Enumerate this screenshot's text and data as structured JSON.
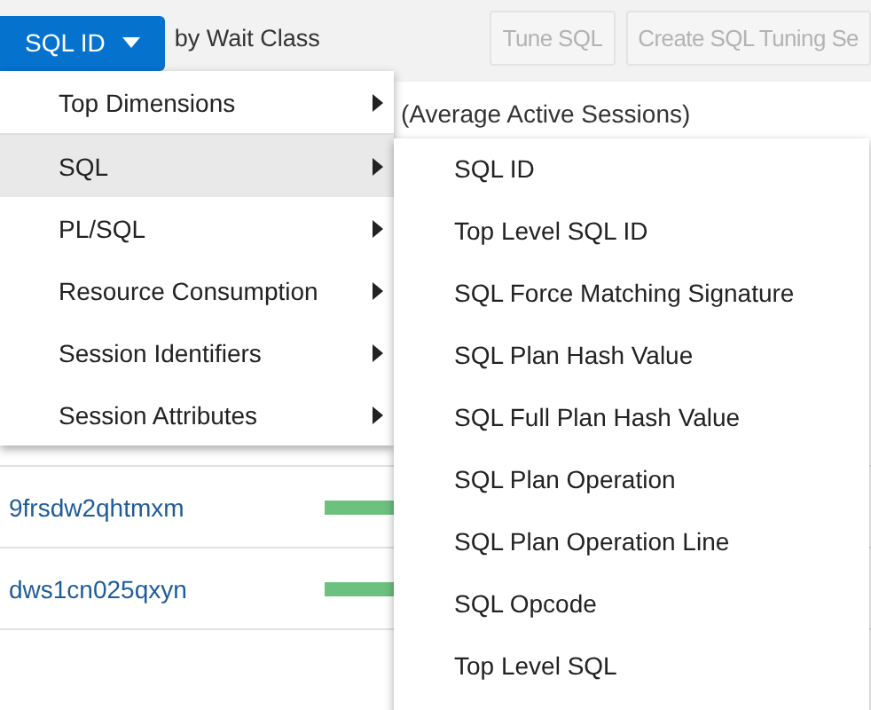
{
  "toolbar": {
    "dimension_button": {
      "label": "SQL ID"
    },
    "by_label": "by Wait Class",
    "buttons": [
      {
        "label": "Tune SQL",
        "disabled": true
      },
      {
        "label": "Create SQL Tuning Se",
        "disabled": true
      }
    ]
  },
  "chart_title": "(Average Active Sessions)",
  "rows": [
    {
      "sql_id": "9frsdw2qhtmxm"
    },
    {
      "sql_id": "dws1cn025qxyn"
    }
  ],
  "menu": {
    "items": [
      {
        "label": "Top Dimensions",
        "selected": false,
        "has_submenu": true
      },
      {
        "label": "SQL",
        "selected": true,
        "has_submenu": true
      },
      {
        "label": "PL/SQL",
        "selected": false,
        "has_submenu": true
      },
      {
        "label": "Resource Consumption",
        "selected": false,
        "has_submenu": true
      },
      {
        "label": "Session Identifiers",
        "selected": false,
        "has_submenu": true
      },
      {
        "label": "Session Attributes",
        "selected": false,
        "has_submenu": true
      }
    ]
  },
  "submenu": {
    "items": [
      {
        "label": "SQL ID"
      },
      {
        "label": "Top Level SQL ID"
      },
      {
        "label": "SQL Force Matching Signature"
      },
      {
        "label": "SQL Plan Hash Value"
      },
      {
        "label": "SQL Full Plan Hash Value"
      },
      {
        "label": "SQL Plan Operation"
      },
      {
        "label": "SQL Plan Operation Line"
      },
      {
        "label": "SQL Opcode"
      },
      {
        "label": "Top Level SQL"
      }
    ]
  }
}
